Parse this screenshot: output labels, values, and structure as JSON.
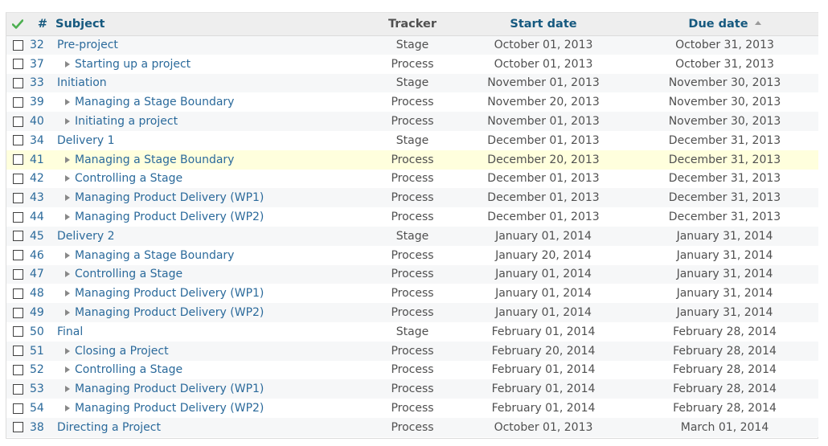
{
  "header": {
    "id_label": "#",
    "subject_label": "Subject",
    "tracker_label": "Tracker",
    "start_label": "Start date",
    "due_label": "Due date"
  },
  "colors": {
    "header_text": "#16597f",
    "link": "#2b6a9b",
    "row_alt": "#f6f7f8",
    "highlight": "#ffffdd",
    "check_icon": "#4caf50"
  },
  "rows": [
    {
      "id": "32",
      "subject": "Pre-project",
      "child": false,
      "tracker": "Stage",
      "start": "October 01, 2013",
      "due": "October 31, 2013"
    },
    {
      "id": "37",
      "subject": "Starting up a project",
      "child": true,
      "tracker": "Process",
      "start": "October 01, 2013",
      "due": "October 31, 2013"
    },
    {
      "id": "33",
      "subject": "Initiation",
      "child": false,
      "tracker": "Stage",
      "start": "November 01, 2013",
      "due": "November 30, 2013"
    },
    {
      "id": "39",
      "subject": "Managing a Stage Boundary",
      "child": true,
      "tracker": "Process",
      "start": "November 20, 2013",
      "due": "November 30, 2013"
    },
    {
      "id": "40",
      "subject": "Initiating a project",
      "child": true,
      "tracker": "Process",
      "start": "November 01, 2013",
      "due": "November 30, 2013"
    },
    {
      "id": "34",
      "subject": "Delivery 1",
      "child": false,
      "tracker": "Stage",
      "start": "December 01, 2013",
      "due": "December 31, 2013"
    },
    {
      "id": "41",
      "subject": "Managing a Stage Boundary",
      "child": true,
      "tracker": "Process",
      "start": "December 20, 2013",
      "due": "December 31, 2013",
      "highlight": true
    },
    {
      "id": "42",
      "subject": "Controlling a Stage",
      "child": true,
      "tracker": "Process",
      "start": "December 01, 2013",
      "due": "December 31, 2013"
    },
    {
      "id": "43",
      "subject": "Managing Product Delivery (WP1)",
      "child": true,
      "tracker": "Process",
      "start": "December 01, 2013",
      "due": "December 31, 2013"
    },
    {
      "id": "44",
      "subject": "Managing Product Delivery (WP2)",
      "child": true,
      "tracker": "Process",
      "start": "December 01, 2013",
      "due": "December 31, 2013"
    },
    {
      "id": "45",
      "subject": "Delivery 2",
      "child": false,
      "tracker": "Stage",
      "start": "January 01, 2014",
      "due": "January 31, 2014"
    },
    {
      "id": "46",
      "subject": "Managing a Stage Boundary",
      "child": true,
      "tracker": "Process",
      "start": "January 20, 2014",
      "due": "January 31, 2014"
    },
    {
      "id": "47",
      "subject": "Controlling a Stage",
      "child": true,
      "tracker": "Process",
      "start": "January 01, 2014",
      "due": "January 31, 2014"
    },
    {
      "id": "48",
      "subject": "Managing Product Delivery (WP1)",
      "child": true,
      "tracker": "Process",
      "start": "January 01, 2014",
      "due": "January 31, 2014"
    },
    {
      "id": "49",
      "subject": "Managing Product Delivery (WP2)",
      "child": true,
      "tracker": "Process",
      "start": "January 01, 2014",
      "due": "January 31, 2014"
    },
    {
      "id": "50",
      "subject": "Final",
      "child": false,
      "tracker": "Stage",
      "start": "February 01, 2014",
      "due": "February 28, 2014"
    },
    {
      "id": "51",
      "subject": "Closing a Project",
      "child": true,
      "tracker": "Process",
      "start": "February 20, 2014",
      "due": "February 28, 2014"
    },
    {
      "id": "52",
      "subject": "Controlling a Stage",
      "child": true,
      "tracker": "Process",
      "start": "February 01, 2014",
      "due": "February 28, 2014"
    },
    {
      "id": "53",
      "subject": "Managing Product Delivery (WP1)",
      "child": true,
      "tracker": "Process",
      "start": "February 01, 2014",
      "due": "February 28, 2014"
    },
    {
      "id": "54",
      "subject": "Managing Product Delivery (WP2)",
      "child": true,
      "tracker": "Process",
      "start": "February 01, 2014",
      "due": "February 28, 2014"
    },
    {
      "id": "38",
      "subject": "Directing a Project",
      "child": false,
      "tracker": "Process",
      "start": "October 01, 2013",
      "due": "March 01, 2014"
    }
  ]
}
